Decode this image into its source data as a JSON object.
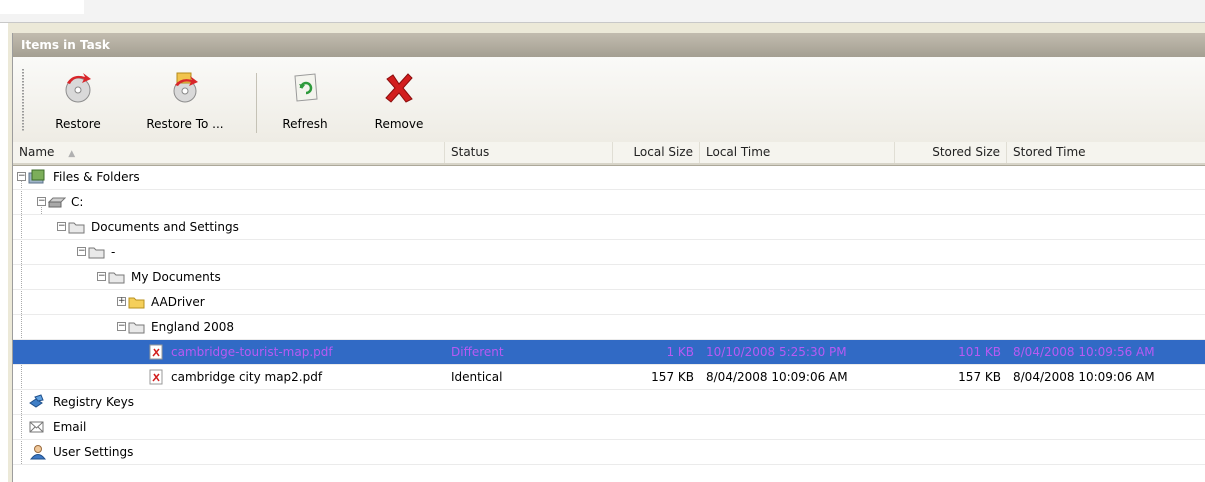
{
  "panel": {
    "title": "Items in Task"
  },
  "toolbar": {
    "restore": "Restore",
    "restore_to": "Restore To ...",
    "refresh": "Refresh",
    "remove": "Remove"
  },
  "columns": {
    "name": "Name",
    "status": "Status",
    "local_size": "Local Size",
    "local_time": "Local Time",
    "stored_size": "Stored Size",
    "stored_time": "Stored Time"
  },
  "tree": {
    "files_folders": "Files & Folders",
    "drive_c": "C:",
    "docs_settings": "Documents and Settings",
    "user_folder": "-",
    "my_documents": "My Documents",
    "aadriver": "AADriver",
    "england_2008": "England 2008",
    "selected_file": {
      "name": "cambridge-tourist-map.pdf",
      "status": "Different",
      "local_size": "1 KB",
      "local_time": "10/10/2008 5:25:30 PM",
      "stored_size": "101 KB",
      "stored_time": "8/04/2008 10:09:56 AM"
    },
    "file2": {
      "name": "cambridge city map2.pdf",
      "status": "Identical",
      "local_size": "157 KB",
      "local_time": "8/04/2008 10:09:06 AM",
      "stored_size": "157 KB",
      "stored_time": "8/04/2008 10:09:06 AM"
    },
    "registry_keys": "Registry Keys",
    "email": "Email",
    "user_settings": "User Settings"
  },
  "colors": {
    "selection": "#316ac5",
    "selected_text": "#b85af3",
    "title_bar": "#a49f92"
  },
  "sort": {
    "column": "Name",
    "direction": "ascending"
  }
}
